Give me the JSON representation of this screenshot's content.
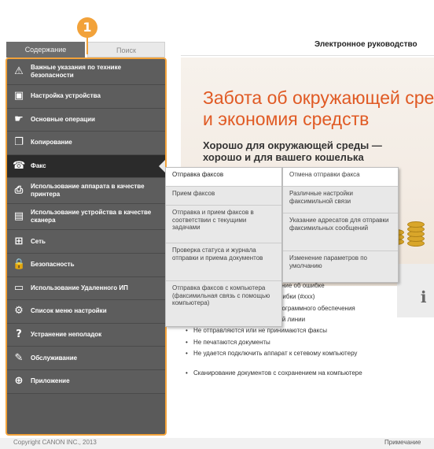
{
  "callout": "1",
  "tabs": {
    "contents": "Содержание",
    "search": "Поиск"
  },
  "header": {
    "title": "Электронное руководство"
  },
  "sidebar": {
    "items": [
      {
        "label": "Важные указания по технике безопасности",
        "icon": "warning-icon"
      },
      {
        "label": "Настройка устройства",
        "icon": "setup-icon"
      },
      {
        "label": "Основные операции",
        "icon": "hand-icon"
      },
      {
        "label": "Копирование",
        "icon": "copy-icon"
      },
      {
        "label": "Факс",
        "icon": "fax-icon"
      },
      {
        "label": "Использование аппарата в качестве принтера",
        "icon": "printer-icon"
      },
      {
        "label": "Использование устройства в качестве сканера",
        "icon": "scanner-icon"
      },
      {
        "label": "Сеть",
        "icon": "network-icon"
      },
      {
        "label": "Безопасность",
        "icon": "lock-icon"
      },
      {
        "label": "Использование Удаленного ИП",
        "icon": "remote-ui-icon"
      },
      {
        "label": "Список меню настройки",
        "icon": "gear-icon"
      },
      {
        "label": "Устранение неполадок",
        "icon": "question-icon"
      },
      {
        "label": "Обслуживание",
        "icon": "wrench-icon"
      },
      {
        "label": "Приложение",
        "icon": "plus-icon"
      }
    ]
  },
  "banner": {
    "title_line1": "Забота об окружающей сре",
    "title_line2": "и экономия средств",
    "sub_line1": "Хорошо для окружающей среды —",
    "sub_line2": "хорошо и для вашего кошелька"
  },
  "flyout1": [
    "Отправка факсов",
    "Прием факсов",
    "Отправка и прием факсов в соответствии с текущими задачами",
    "Проверка статуса и журнала отправки и приема документов",
    "Отправка факсов с компьютера (факсимильная связь с помощью компьютера)"
  ],
  "flyout2": [
    "Отмена отправки факса",
    "Различные настройки факсимильной связи",
    "Указание адресатов для отправки факсимильных сообщений",
    "Изменение параметров по умолчанию"
  ],
  "main_list": {
    "frag1": "щение об ошибке",
    "frag2": "шибки (#xxx)",
    "frag3": "рограммного обеспечения",
    "frag4": "ной линии",
    "b1": "Не отправляются или не принимаются факсы",
    "b2": "Не печатаются документы",
    "b3": "Не удается подключить аппарат к сетевому компьютеру",
    "b4": "Сканирование документов с сохранением на компьютере"
  },
  "footer": {
    "copyright": "Copyright CANON INC., 2013",
    "notes": "Примечание"
  },
  "colors": {
    "accent": "#f2a23a",
    "banner_title": "#e05a24",
    "sidebar": "#5a5a5a"
  }
}
